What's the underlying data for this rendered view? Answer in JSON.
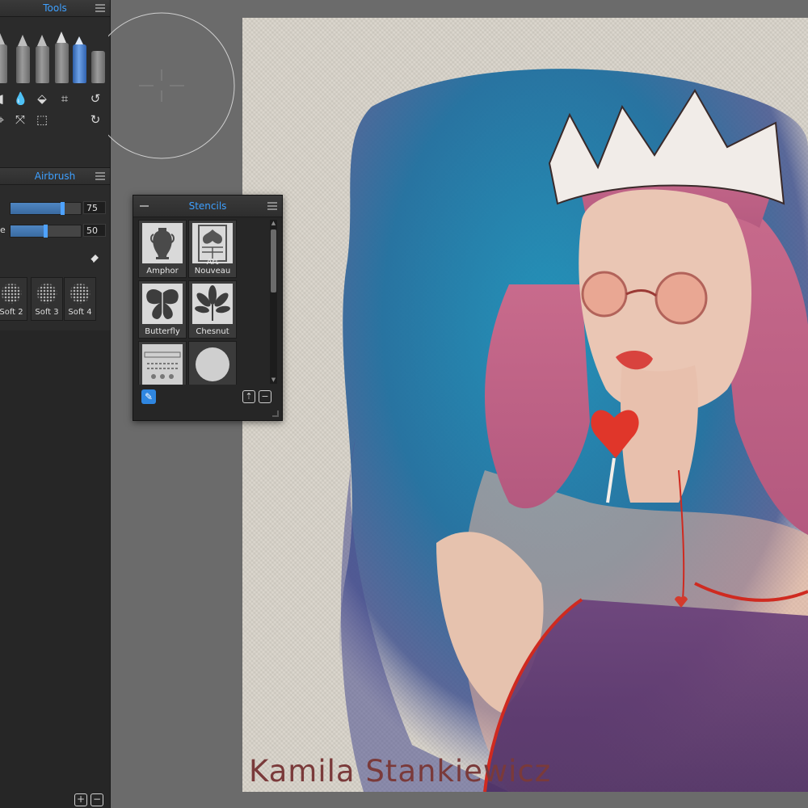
{
  "tools_panel": {
    "title": "Tools",
    "tool_icons": [
      "pencil-icon",
      "pen-icon",
      "fountain-pen-icon",
      "marker-icon",
      "spray-can-icon",
      "eraser-icon",
      "blob-icon",
      "drop-icon",
      "ruler-icon",
      "crop-icon",
      "undo-icon",
      "transform-icon",
      "fit-icon",
      "selection-icon",
      "redo-icon"
    ]
  },
  "airbrush_panel": {
    "title": "Airbrush",
    "sliders": [
      {
        "label": "",
        "value": "75",
        "fraction": 0.75
      },
      {
        "label": "e",
        "value": "50",
        "fraction": 0.5
      }
    ],
    "presets": [
      {
        "label": "Soft 2"
      },
      {
        "label": "Soft 3"
      },
      {
        "label": "Soft 4"
      }
    ]
  },
  "stencils_panel": {
    "title": "Stencils",
    "items": [
      {
        "label": "Amphor"
      },
      {
        "label": "Art Nouveau"
      },
      {
        "label": "Butterfly"
      },
      {
        "label": "Chesnut"
      },
      {
        "label": ""
      },
      {
        "label": ""
      }
    ]
  },
  "canvas": {
    "signature": "Kamila Stankiewicz"
  },
  "colors": {
    "accent": "#3ea0ff",
    "panel_bg": "#262626",
    "workspace_bg": "#6b6b6b",
    "paper": "#d8d3c9",
    "signature": "#7a3a3a"
  }
}
